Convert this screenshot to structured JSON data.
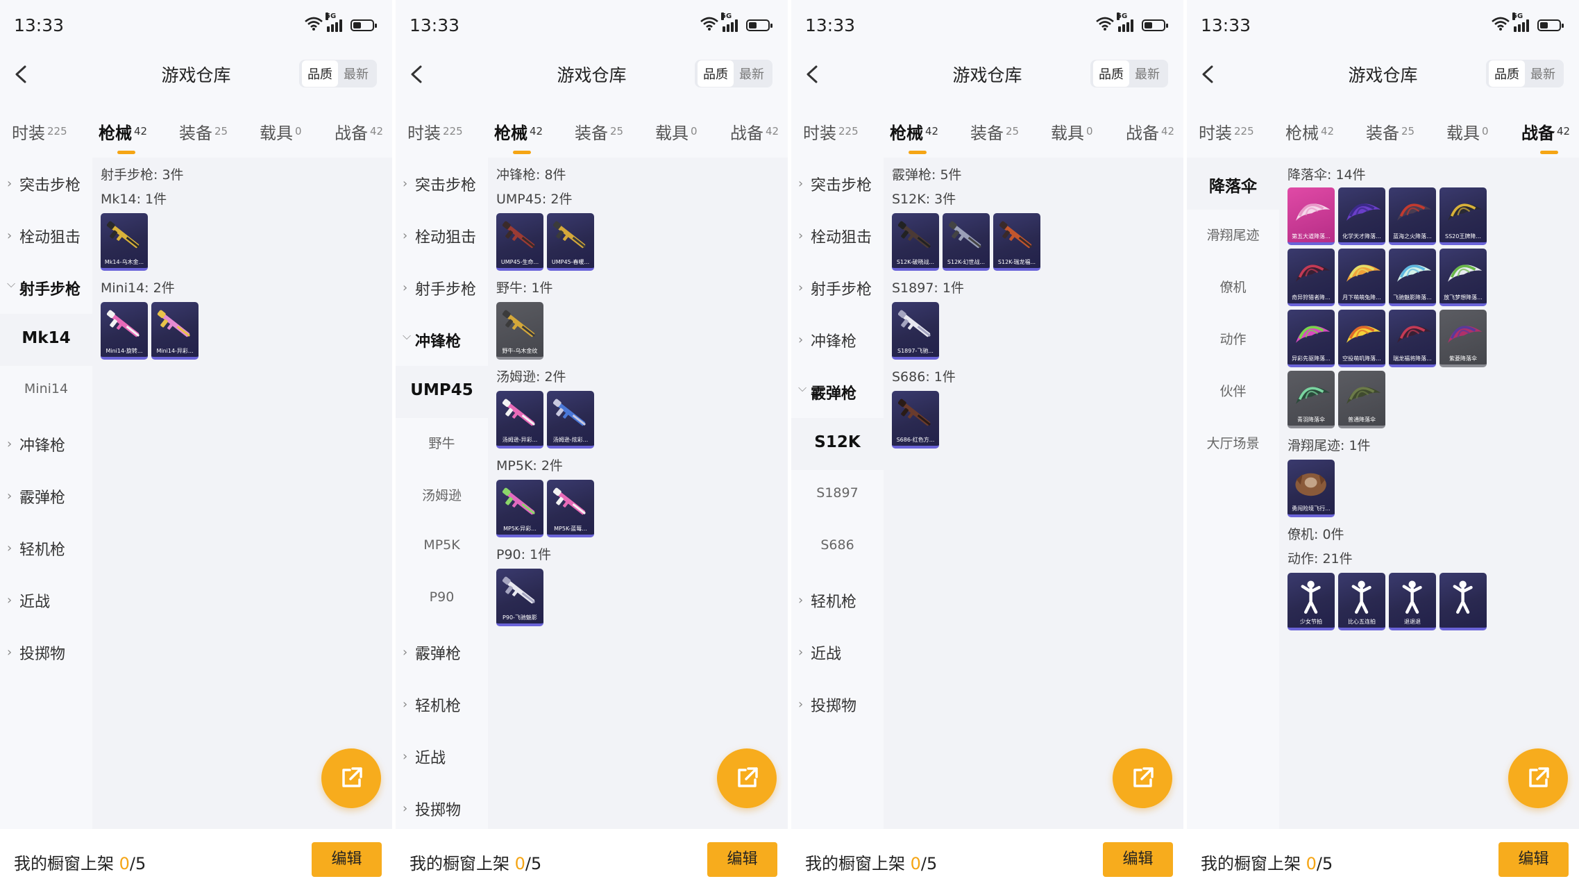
{
  "common": {
    "time": "13:33",
    "network": "5G",
    "title": "游戏仓库",
    "sort": [
      "品质",
      "最新"
    ],
    "tabs": [
      {
        "label": "时装",
        "count": "225"
      },
      {
        "label": "枪械",
        "count": "42"
      },
      {
        "label": "装备",
        "count": "25"
      },
      {
        "label": "载具",
        "count": "0"
      },
      {
        "label": "战备",
        "count": "42"
      }
    ],
    "showcase_label": "我的橱窗上架 ",
    "showcase_count": "0",
    "showcase_total": "/5",
    "edit_label": "编辑"
  },
  "panels": [
    {
      "active_tab": 1,
      "sidebar": [
        {
          "label": "突击步枪",
          "type": "collapsed"
        },
        {
          "label": "栓动狙击",
          "type": "collapsed"
        },
        {
          "label": "射手步枪",
          "type": "open"
        },
        {
          "label": "Mk14",
          "type": "sub",
          "selected": true
        },
        {
          "label": "Mini14",
          "type": "sub"
        },
        {
          "label": "冲锋枪",
          "type": "collapsed"
        },
        {
          "label": "霰弹枪",
          "type": "collapsed"
        },
        {
          "label": "轻机枪",
          "type": "collapsed"
        },
        {
          "label": "近战",
          "type": "collapsed"
        },
        {
          "label": "投掷物",
          "type": "collapsed"
        }
      ],
      "header": "射手步枪: 3件",
      "groups": [
        {
          "title": "Mk14: 1件",
          "items": [
            {
              "caption": "Mk14-乌木金...",
              "icon": "gold-rifle-icon",
              "art": "gold",
              "style": "purple"
            }
          ]
        },
        {
          "title": "Mini14: 2件",
          "items": [
            {
              "caption": "Mini14-旋转...",
              "icon": "pink-rifle-icon",
              "art": "pink",
              "style": "purple"
            },
            {
              "caption": "Mini14-异彩...",
              "icon": "pink-rifle-icon",
              "art": "pinkgold",
              "style": "purple"
            }
          ]
        }
      ]
    },
    {
      "active_tab": 1,
      "sidebar": [
        {
          "label": "突击步枪",
          "type": "collapsed"
        },
        {
          "label": "栓动狙击",
          "type": "collapsed"
        },
        {
          "label": "射手步枪",
          "type": "collapsed"
        },
        {
          "label": "冲锋枪",
          "type": "open"
        },
        {
          "label": "UMP45",
          "type": "sub",
          "selected": true
        },
        {
          "label": "野牛",
          "type": "sub"
        },
        {
          "label": "汤姆逊",
          "type": "sub"
        },
        {
          "label": "MP5K",
          "type": "sub"
        },
        {
          "label": "P90",
          "type": "sub"
        },
        {
          "label": "霰弹枪",
          "type": "collapsed"
        },
        {
          "label": "轻机枪",
          "type": "collapsed"
        },
        {
          "label": "近战",
          "type": "collapsed"
        },
        {
          "label": "投掷物",
          "type": "collapsed"
        }
      ],
      "header": "冲锋枪: 8件",
      "groups": [
        {
          "title": "UMP45: 2件",
          "items": [
            {
              "caption": "UMP45-生命...",
              "icon": "red-smg-icon",
              "art": "red",
              "style": "purple"
            },
            {
              "caption": "UMP45-春暖...",
              "icon": "gold-smg-icon",
              "art": "goldsmg",
              "style": "purple"
            }
          ]
        },
        {
          "title": "野牛: 1件",
          "items": [
            {
              "caption": "野牛-乌木金纹",
              "icon": "gold-smg-icon",
              "art": "goldsmg",
              "style": "gray"
            }
          ]
        },
        {
          "title": "汤姆逊: 2件",
          "items": [
            {
              "caption": "汤姆逊-异彩...",
              "icon": "pink-smg-icon",
              "art": "pink",
              "style": "purple"
            },
            {
              "caption": "汤姆逊-炫彩...",
              "icon": "blue-smg-icon",
              "art": "blue",
              "style": "purple"
            }
          ]
        },
        {
          "title": "MP5K: 2件",
          "items": [
            {
              "caption": "MP5K-异彩...",
              "icon": "pink-smg-icon",
              "art": "pinkgreen",
              "style": "purple"
            },
            {
              "caption": "MP5K-蓝莓...",
              "icon": "pink-smg-icon",
              "art": "pink",
              "style": "purple"
            }
          ]
        },
        {
          "title": "P90: 1件",
          "items": [
            {
              "caption": "P90-飞驰魅影",
              "icon": "p90-icon",
              "art": "white",
              "style": "purple"
            }
          ]
        }
      ]
    },
    {
      "active_tab": 1,
      "sidebar": [
        {
          "label": "突击步枪",
          "type": "collapsed"
        },
        {
          "label": "栓动狙击",
          "type": "collapsed"
        },
        {
          "label": "射手步枪",
          "type": "collapsed"
        },
        {
          "label": "冲锋枪",
          "type": "collapsed"
        },
        {
          "label": "霰弹枪",
          "type": "open"
        },
        {
          "label": "S12K",
          "type": "sub",
          "selected": true
        },
        {
          "label": "S1897",
          "type": "sub"
        },
        {
          "label": "S686",
          "type": "sub"
        },
        {
          "label": "轻机枪",
          "type": "collapsed"
        },
        {
          "label": "近战",
          "type": "collapsed"
        },
        {
          "label": "投掷物",
          "type": "collapsed"
        }
      ],
      "header": "霰弹枪: 5件",
      "groups": [
        {
          "title": "S12K: 3件",
          "items": [
            {
              "caption": "S12K-破晓战...",
              "icon": "dark-shotgun-icon",
              "art": "dark",
              "style": "purple"
            },
            {
              "caption": "S12K-幻世战...",
              "icon": "silver-shotgun-icon",
              "art": "silver",
              "style": "purple"
            },
            {
              "caption": "S12K-瑞龙福...",
              "icon": "red-shotgun-icon",
              "art": "orange",
              "style": "purple"
            }
          ]
        },
        {
          "title": "S1897: 1件",
          "items": [
            {
              "caption": "S1897-飞驰...",
              "icon": "white-shotgun-icon",
              "art": "white",
              "style": "purple"
            }
          ]
        },
        {
          "title": "S686: 1件",
          "items": [
            {
              "caption": "S686-红色方...",
              "icon": "red-shotgun-icon",
              "art": "brown",
              "style": "purple"
            }
          ]
        }
      ]
    },
    {
      "active_tab": 4,
      "sidebar": [
        {
          "label": "降落伞",
          "type": "plain",
          "selected": true
        },
        {
          "label": "滑翔尾迹",
          "type": "plain"
        },
        {
          "label": "僚机",
          "type": "plain"
        },
        {
          "label": "动作",
          "type": "plain"
        },
        {
          "label": "伙伴",
          "type": "plain"
        },
        {
          "label": "大厅场景",
          "type": "plain"
        }
      ],
      "header": "降落伞: 14件",
      "groups": [
        {
          "title": "",
          "items": [
            {
              "caption": "第五大道降落...",
              "icon": "parachute-icon",
              "art": "chute-pink",
              "style": "pink"
            },
            {
              "caption": "化学天才降落...",
              "icon": "parachute-icon",
              "art": "chute-purple",
              "style": "purple"
            },
            {
              "caption": "蓝海之火降落...",
              "icon": "parachute-icon",
              "art": "chute-dark",
              "style": "purple"
            },
            {
              "caption": "SS20王牌降...",
              "icon": "parachute-icon",
              "art": "chute-gold",
              "style": "purple"
            },
            {
              "caption": "奇异狩猎者降...",
              "icon": "parachute-icon",
              "art": "chute-red",
              "style": "purple"
            },
            {
              "caption": "月下萌萌兔降...",
              "icon": "parachute-icon",
              "art": "chute-orange",
              "style": "purple"
            },
            {
              "caption": "飞驰魅影降落...",
              "icon": "parachute-icon",
              "art": "chute-cyan",
              "style": "purple"
            },
            {
              "caption": "放飞梦想降落...",
              "icon": "parachute-icon",
              "art": "chute-green",
              "style": "purple"
            },
            {
              "caption": "异彩先驱降落...",
              "icon": "parachute-icon",
              "art": "chute-multi",
              "style": "purple"
            },
            {
              "caption": "空投萌叽降落...",
              "icon": "parachute-icon",
              "art": "chute-yellow",
              "style": "purple"
            },
            {
              "caption": "瑞龙福将降落...",
              "icon": "parachute-icon",
              "art": "chute-red",
              "style": "purple"
            },
            {
              "caption": "紫菱降落伞",
              "icon": "parachute-icon",
              "art": "chute-stripe",
              "style": "gray"
            },
            {
              "caption": "青羽降落伞",
              "icon": "parachute-icon",
              "art": "chute-teal",
              "style": "gray"
            },
            {
              "caption": "普通降落伞",
              "icon": "parachute-icon",
              "art": "chute-olive",
              "style": "gray"
            }
          ]
        },
        {
          "title": "滑翔尾迹: 1件",
          "items": [
            {
              "caption": "勇闯险境飞行...",
              "icon": "trail-icon",
              "art": "trail",
              "style": "purple"
            }
          ]
        },
        {
          "title": "僚机: 0件",
          "items": []
        },
        {
          "title": "动作: 21件",
          "items": [
            {
              "caption": "少女节拍",
              "icon": "emote-icon",
              "art": "emote",
              "style": "purple"
            },
            {
              "caption": "比心五连拍",
              "icon": "emote-icon",
              "art": "emote",
              "style": "purple"
            },
            {
              "caption": "退退退",
              "icon": "emote-icon",
              "art": "emote",
              "style": "purple"
            },
            {
              "caption": "",
              "icon": "emote-icon",
              "art": "emote",
              "style": "purple"
            }
          ]
        }
      ]
    }
  ]
}
